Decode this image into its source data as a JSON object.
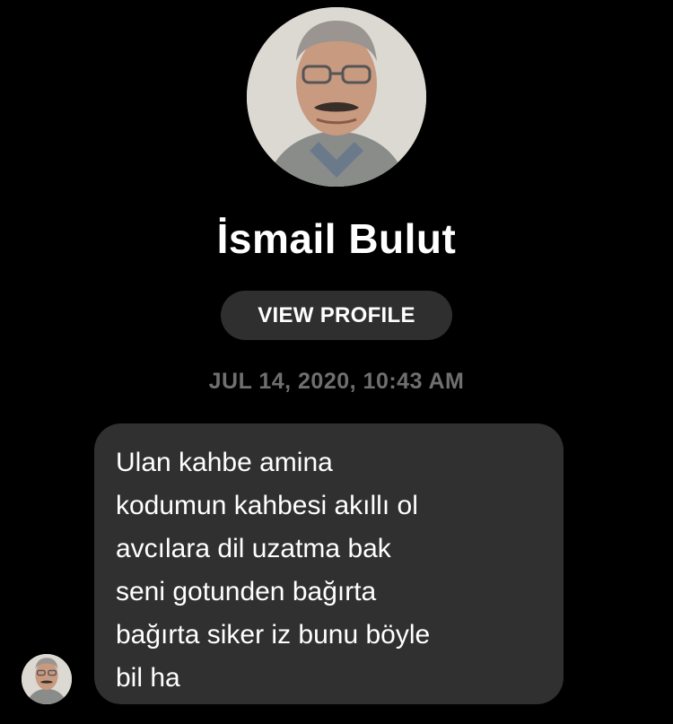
{
  "contact": {
    "name": "İsmail Bulut",
    "view_profile_label": "VIEW PROFILE"
  },
  "conversation": {
    "timestamp": "JUL 14, 2020, 10:43 AM",
    "messages": [
      {
        "text": "Ulan kahbe amina\nkodumun kahbesi akıllı ol\navcılara dil uzatma bak\nseni gotunden bağırta\nbağırta siker iz bunu böyle\nbil ha"
      }
    ]
  },
  "colors": {
    "background": "#000000",
    "bubble": "#303030",
    "button": "#2f2f2f",
    "timestamp": "#6f6f6f",
    "text": "#ffffff"
  },
  "icons": {
    "profile_photo": "profile-photo",
    "sender_avatar": "sender-avatar"
  }
}
